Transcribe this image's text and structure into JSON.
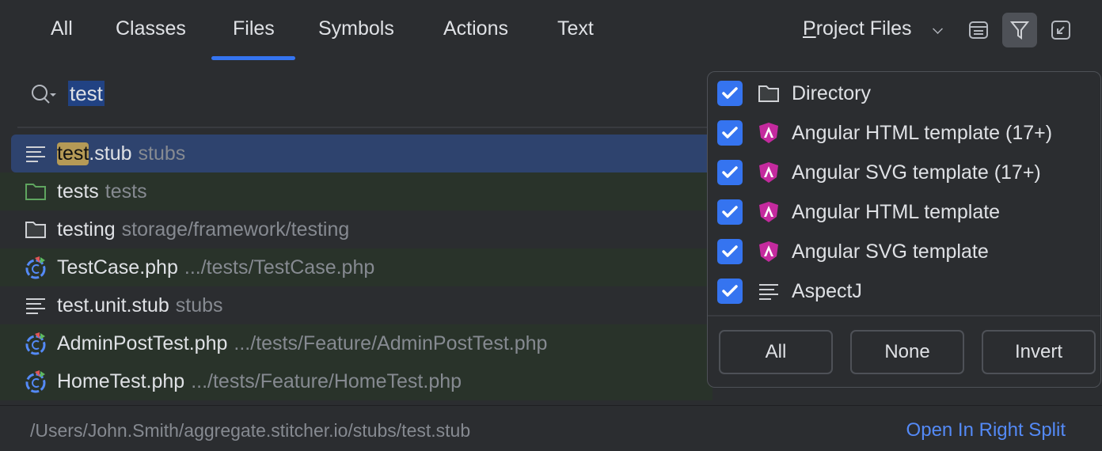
{
  "tabs": [
    {
      "label": "All"
    },
    {
      "label": "Classes"
    },
    {
      "label": "Files",
      "active": true
    },
    {
      "label": "Symbols"
    },
    {
      "label": "Actions"
    },
    {
      "label": "Text"
    }
  ],
  "scope": {
    "label_u": "P",
    "label_rest": "roject Files"
  },
  "search": {
    "query": "test"
  },
  "results": [
    {
      "hl": "test",
      "name": ".stub",
      "path": "stubs",
      "icon": "text-file-icon",
      "style": "sel"
    },
    {
      "name": "tests",
      "path": "tests",
      "icon": "test-folder-icon",
      "style": "green"
    },
    {
      "name": "testing",
      "path": "storage/framework/testing",
      "icon": "folder-icon",
      "style": ""
    },
    {
      "name": "TestCase.php",
      "path": ".../tests/TestCase.php",
      "icon": "php-test-class-icon",
      "style": "green"
    },
    {
      "name": "test.unit.stub",
      "path": "stubs",
      "icon": "text-file-icon",
      "style": ""
    },
    {
      "name": "AdminPostTest.php",
      "path": ".../tests/Feature/AdminPostTest.php",
      "icon": "php-test-class-icon",
      "style": "green"
    },
    {
      "name": "HomeTest.php",
      "path": ".../tests/Feature/HomeTest.php",
      "icon": "php-test-class-icon",
      "style": "green"
    }
  ],
  "footer": {
    "path": "/Users/John.Smith/aggregate.stitcher.io/stubs/test.stub",
    "action": "Open In Right Split"
  },
  "filter": {
    "items": [
      {
        "label": "Directory",
        "icon": "folder-icon",
        "checked": true
      },
      {
        "label": "Angular HTML template (17+)",
        "icon": "angular-icon",
        "checked": true
      },
      {
        "label": "Angular SVG template (17+)",
        "icon": "angular-icon",
        "checked": true
      },
      {
        "label": "Angular HTML template",
        "icon": "angular-icon",
        "checked": true
      },
      {
        "label": "Angular SVG template",
        "icon": "angular-icon",
        "checked": true
      },
      {
        "label": "AspectJ",
        "icon": "text-file-icon",
        "checked": true
      }
    ],
    "buttons": {
      "all": "All",
      "none": "None",
      "invert": "Invert"
    }
  },
  "colors": {
    "accent": "#3574f0",
    "link": "#548af7",
    "highlight": "#b59a56"
  }
}
